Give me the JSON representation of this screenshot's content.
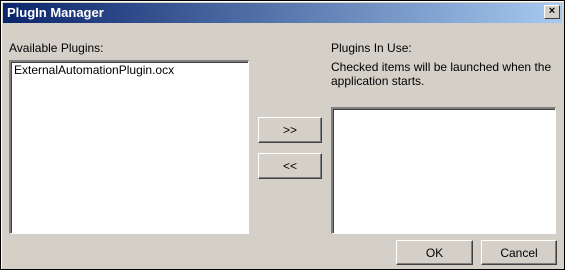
{
  "window": {
    "title": "PlugIn Manager",
    "close_glyph": "×",
    "titlebar_color_start": "#0a246a",
    "titlebar_color_end": "#a6caf0",
    "face_color": "#d4d0c8"
  },
  "available": {
    "label": "Available Plugins:",
    "items": [
      "ExternalAutomationPlugin.ocx"
    ]
  },
  "in_use": {
    "label": "Plugins In Use:",
    "description_line1": "Checked items will be launched when the",
    "description_line2": "application starts.",
    "items": []
  },
  "buttons": {
    "add_label": ">>",
    "remove_label": "<<",
    "ok_label": "OK",
    "cancel_label": "Cancel"
  },
  "icons": {
    "close": "close-icon"
  }
}
